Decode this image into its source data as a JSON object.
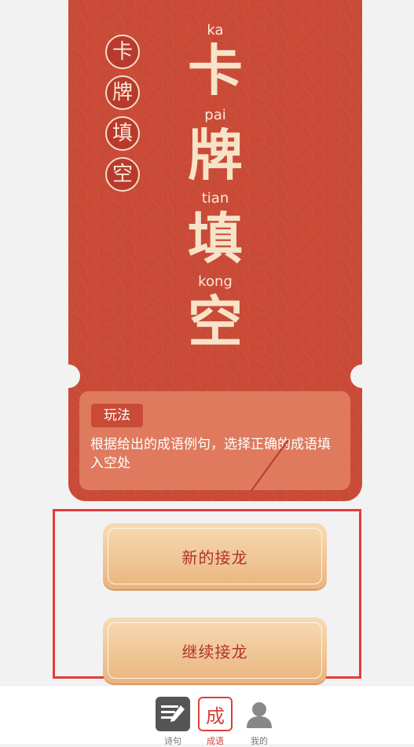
{
  "title": {
    "side_chars": [
      "卡",
      "牌",
      "填",
      "空"
    ],
    "pinyin": [
      "ka",
      "pai",
      "tian",
      "kong"
    ],
    "big_chars": [
      "卡",
      "牌",
      "填",
      "空"
    ]
  },
  "rules": {
    "tag": "玩法",
    "text": "根据给出的成语例句，选择正确的成语填入空处"
  },
  "buttons": {
    "new_game": "新的接龙",
    "continue_game": "继续接龙"
  },
  "tabbar": {
    "items": [
      {
        "label": "诗句",
        "icon": "pencil-note-icon"
      },
      {
        "label": "成语",
        "icon": "cheng-character-icon",
        "active": true,
        "glyph": "成"
      },
      {
        "label": "我的",
        "icon": "user-icon"
      }
    ]
  },
  "colors": {
    "card": "#c94a37",
    "accent": "#d6413a",
    "button": "#eab47d"
  }
}
